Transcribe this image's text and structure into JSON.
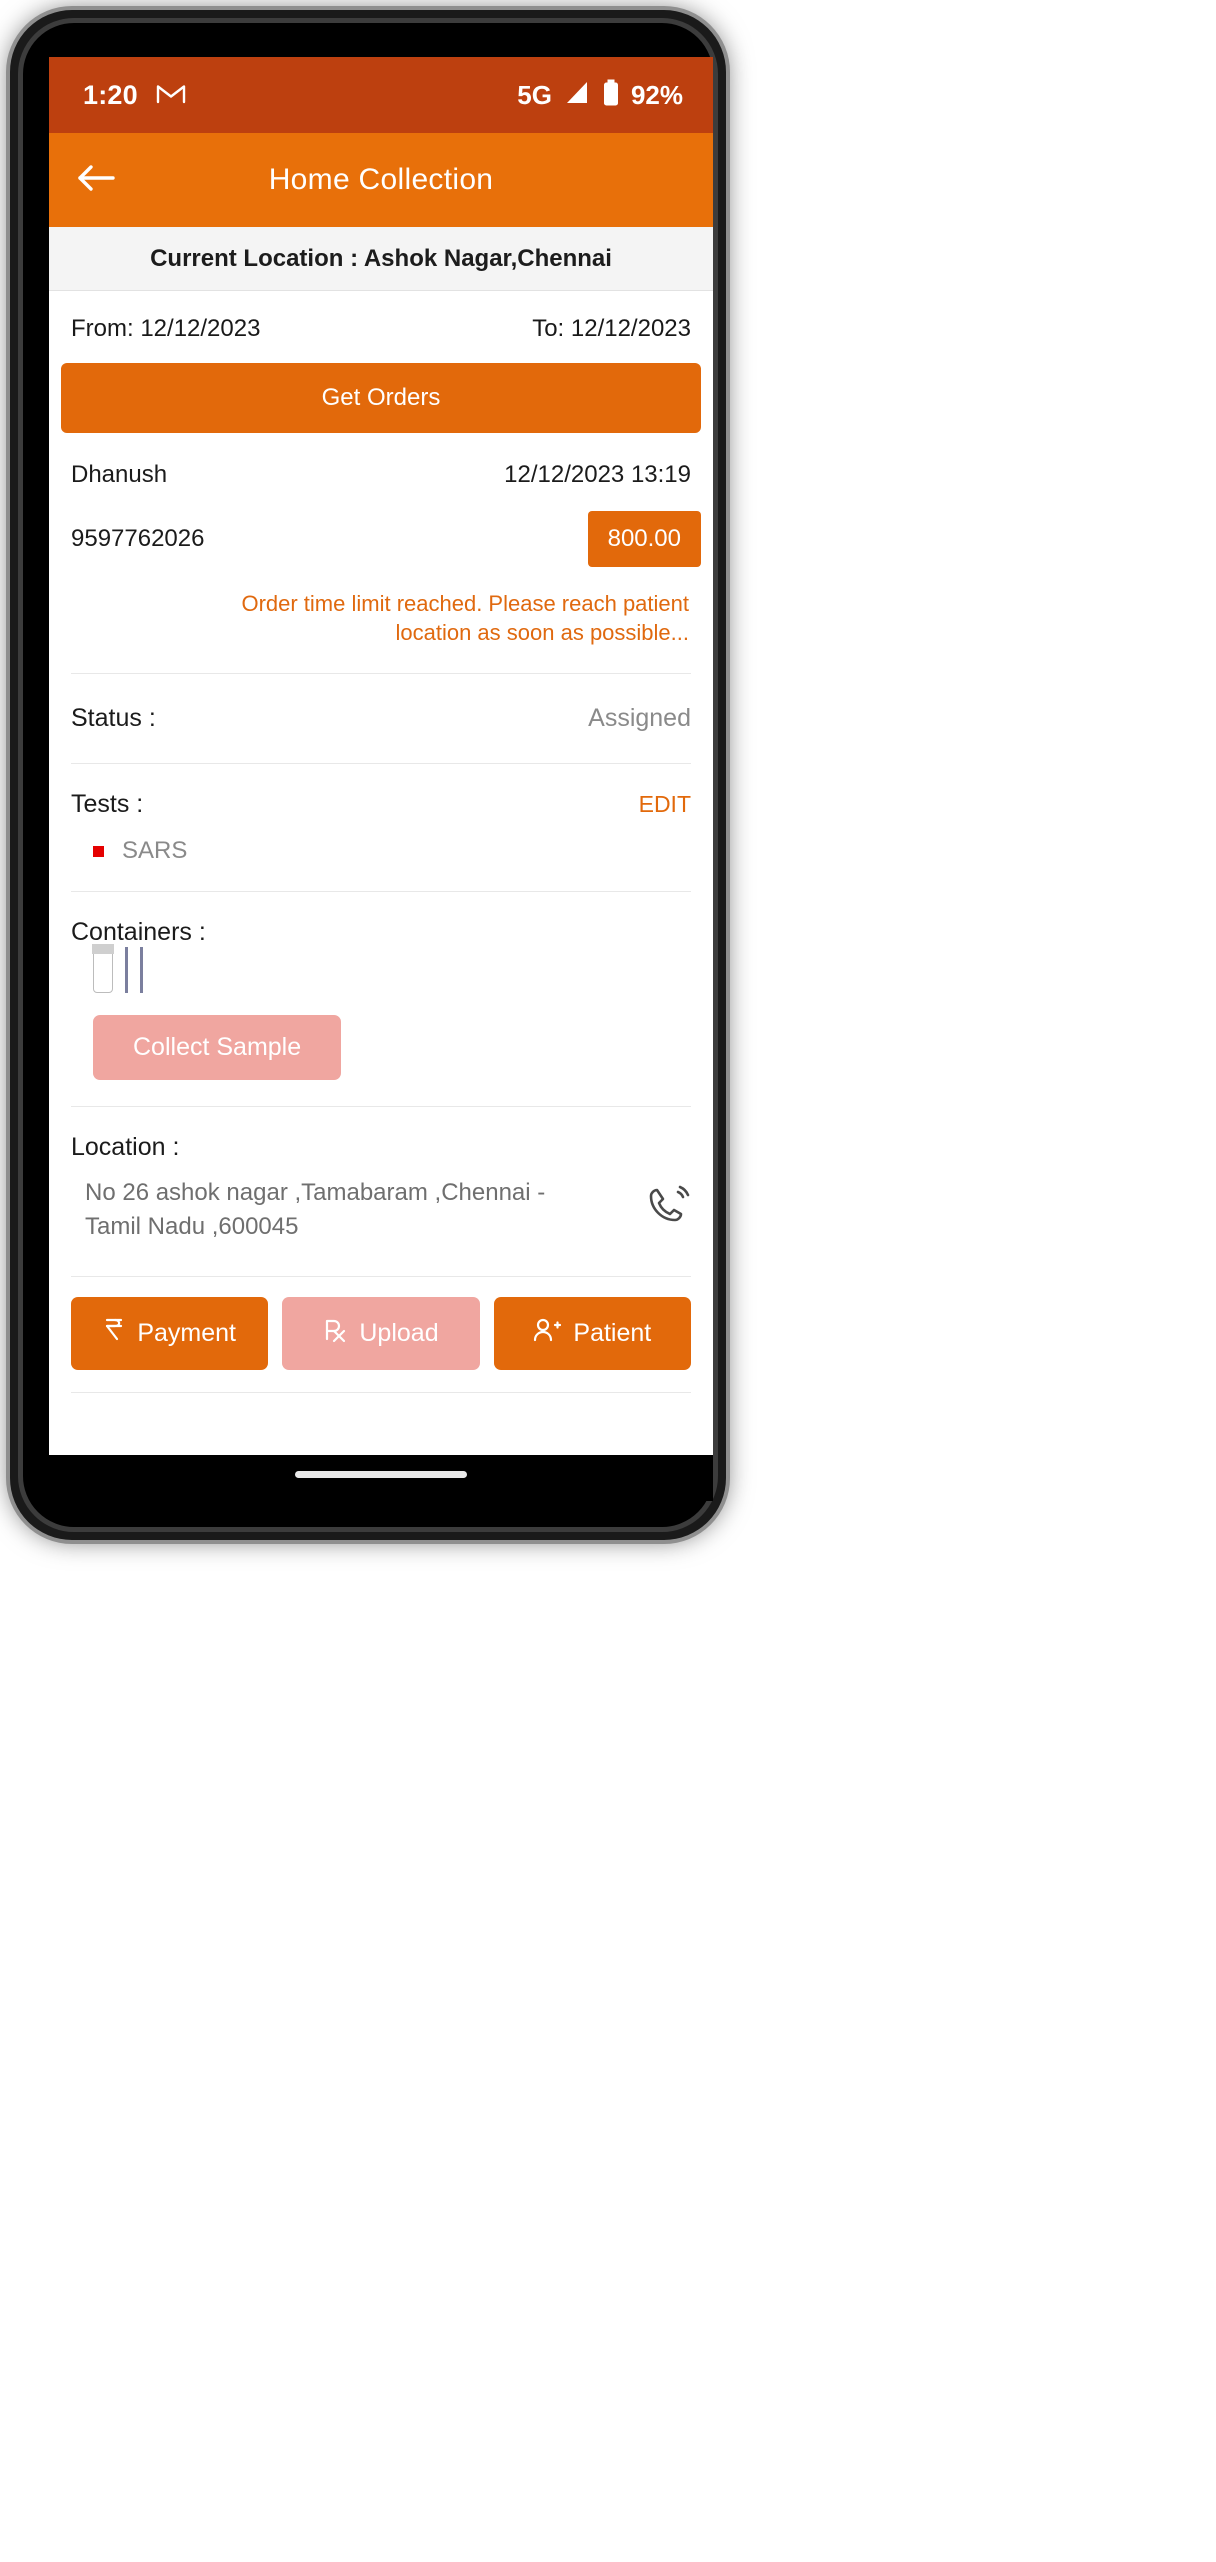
{
  "status_bar": {
    "time": "1:20",
    "gmail_icon": "gmail-icon",
    "network": "5G",
    "signal_icon": "signal-bars-icon",
    "battery_icon": "battery-icon",
    "battery_percent": "92%"
  },
  "app_bar": {
    "back_icon": "back-arrow-icon",
    "title": "Home Collection"
  },
  "location_strip": {
    "text": "Current Location : Ashok Nagar,Chennai"
  },
  "filters": {
    "from_label": "From: 12/12/2023",
    "to_label": "To: 12/12/2023",
    "get_orders_label": "Get Orders"
  },
  "order": {
    "patient_name": "Dhanush",
    "datetime": "12/12/2023 13:19",
    "phone": "9597762026",
    "amount": "800.00",
    "warning": "Order time limit reached. Please reach patient location as soon as possible...",
    "status_label": "Status :",
    "status_value": "Assigned",
    "tests_label": "Tests :",
    "tests_edit_label": "EDIT",
    "tests": [
      "SARS"
    ],
    "containers_label": "Containers :",
    "container_icons": [
      "specimen-tube-icon",
      "specimen-tube-icon"
    ],
    "collect_sample_label": "Collect Sample",
    "location_label": "Location :",
    "address": "No 26 ashok nagar ,Tamabaram ,Chennai - Tamil Nadu ,600045",
    "call_icon": "phone-call-icon"
  },
  "actions": [
    {
      "label": "Payment",
      "icon": "rupee-icon",
      "style": "orange"
    },
    {
      "label": "Upload",
      "icon": "prescription-icon",
      "style": "pink"
    },
    {
      "label": "Patient",
      "icon": "add-person-icon",
      "style": "orange"
    }
  ],
  "colors": {
    "status_bar": "#bd400f",
    "app_bar": "#e8700a",
    "accent": "#e2690b",
    "disabled": "#f0a6a0",
    "warning_text": "#e0690f",
    "muted_text": "#8a8a8a",
    "bullet": "#e50000"
  }
}
